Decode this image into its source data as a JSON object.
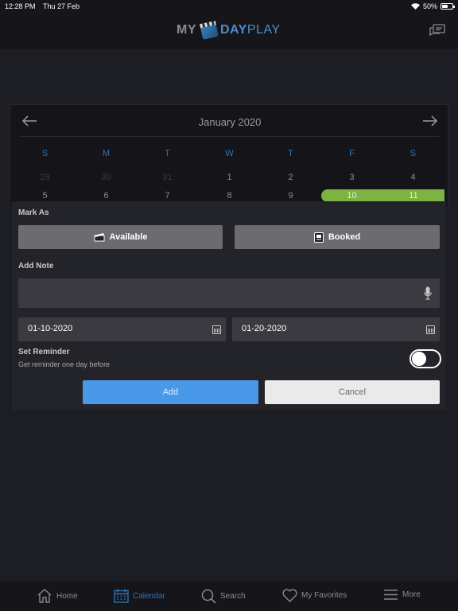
{
  "status_bar": {
    "time": "12:28 PM",
    "date": "Thu 27 Feb",
    "battery": "50%"
  },
  "header": {
    "logo_my": "MY",
    "logo_day": "DAY",
    "logo_play": "PLAY"
  },
  "calendar": {
    "month": "January 2020",
    "weekdays": [
      "S",
      "M",
      "T",
      "W",
      "T",
      "F",
      "S"
    ],
    "row1": [
      "29",
      "30",
      "31",
      "1",
      "2",
      "3",
      "4"
    ],
    "row2": [
      "5",
      "6",
      "7",
      "8",
      "9",
      "10",
      "11"
    ],
    "booked_color": "#7cb342"
  },
  "panel": {
    "mark_as_label": "Mark As",
    "available_label": "Available",
    "booked_label": "Booked",
    "add_note_label": "Add Note",
    "note_value": "",
    "start_date": "01-10-2020",
    "end_date": "01-20-2020",
    "reminder_title": "Set Reminder",
    "reminder_subtitle": "Get reminder one day before",
    "reminder_on": false,
    "add_label": "Add",
    "cancel_label": "Cancel",
    "accent": "#4a98e8"
  },
  "tabs": [
    {
      "label": "Home",
      "icon": "home-icon"
    },
    {
      "label": "Calendar",
      "icon": "calendar-icon",
      "active": true
    },
    {
      "label": "Search",
      "icon": "search-icon"
    },
    {
      "label": "My Favorites",
      "icon": "heart-icon"
    },
    {
      "label": "More",
      "icon": "menu-icon"
    }
  ]
}
